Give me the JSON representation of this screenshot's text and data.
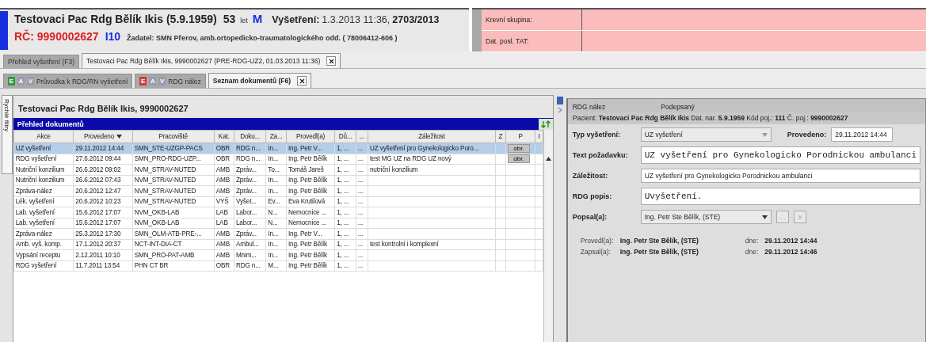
{
  "patient_header": {
    "name": "Testovaci Pac Rdg Bělík Ikis (5.9.1959)",
    "age": "53",
    "age_unit": "let",
    "sex": "M",
    "exam_label": "Vyšetření:",
    "exam_datetime": "1.3.2013 11:36,",
    "exam_number": "2703/2013",
    "rc": "RČ: 9990002627",
    "code": "I10",
    "requester": "Žadatel: SMN Přerov, amb.ortopedicko-traumatologického odd. ( 78006412-606 )"
  },
  "info_fields": [
    {
      "label": "Krevní skupina:"
    },
    {
      "label": "Dat. posl. TAT:"
    }
  ],
  "tabs": [
    {
      "label": "Přehled vyšetření (F3)",
      "selected": false,
      "closable": false
    },
    {
      "label": "Testovaci Pac Rdg Bělík Ikis, 9990002627 (PRE-RDG-UZ2, 01.03.2013 11:36)",
      "selected": true,
      "closable": true
    }
  ],
  "subtabs": [
    {
      "label": "Průvodka k RDG/RN vyšetření",
      "selected": false,
      "closable": false,
      "badges": [
        {
          "text": "E",
          "color": "#2e9e3e"
        },
        {
          "text": "A",
          "color": "#9a9ab0"
        },
        {
          "text": "V",
          "color": "#9a9ab0"
        }
      ]
    },
    {
      "label": "RDG nález",
      "selected": false,
      "closable": false,
      "badges": [
        {
          "text": "E",
          "color": "#d23a3a"
        },
        {
          "text": "A",
          "color": "#9a9ab0"
        },
        {
          "text": "V",
          "color": "#9a9ab0"
        }
      ]
    },
    {
      "label": "Seznam dokumentů (F6)",
      "selected": true,
      "closable": true
    }
  ],
  "side_tab": {
    "label": "Rychlé filtry"
  },
  "documents": {
    "title": "Testovaci Pac Rdg Bělík Ikis, 9990002627",
    "bar_title": "Přehled dokumentů",
    "columns": [
      {
        "label": "Akce",
        "sorted": false
      },
      {
        "label": "Provedeno",
        "sorted": true
      },
      {
        "label": "Pracoviště",
        "sorted": false
      },
      {
        "label": "Kat.",
        "sorted": false
      },
      {
        "label": "Doku...",
        "sorted": false
      },
      {
        "label": "Za...",
        "sorted": false
      },
      {
        "label": "Provedl(a)",
        "sorted": false
      },
      {
        "label": "Dů...",
        "sorted": false
      },
      {
        "label": "...",
        "sorted": false
      },
      {
        "label": "Záležitost",
        "sorted": false
      },
      {
        "label": "Z",
        "sorted": false
      },
      {
        "label": "P",
        "sorted": false
      },
      {
        "label": "I",
        "sorted": false
      }
    ],
    "rows": [
      {
        "selected": true,
        "cells": [
          "UZ vyšetření",
          "29.11.2012 14:44",
          "SMN_STE-UZGP-PACS",
          "OBR",
          "RDG n...",
          "In...",
          "Ing. Petr V...",
          "1, ...",
          "...",
          "UZ vyšetření pro Gynekologicko Poro..."
        ],
        "p": "obr."
      },
      {
        "selected": false,
        "cells": [
          "RDG vyšetření",
          "27.6.2012 09:44",
          "SMN_PRO-RDG-UZP...",
          "OBR",
          "RDG n...",
          "In...",
          "Ing. Petr Bělík",
          "1, ...",
          "...",
          "test MG UZ na RDG UZ nový"
        ],
        "p": "obr."
      },
      {
        "selected": false,
        "cells": [
          "Nutriční konzilium",
          "26.6.2012 09:02",
          "NVM_STRAV-NUTED",
          "AMB",
          "Zpráv...",
          "To...",
          "Tomáš Jareš",
          "1, ...",
          "...",
          "nutriční konzilium"
        ]
      },
      {
        "selected": false,
        "cells": [
          "Nutriční konzilium",
          "26.6.2012 07:43",
          "NVM_STRAV-NUTED",
          "AMB",
          "Zpráv...",
          "In...",
          "Ing. Petr Bělík",
          "1, ...",
          "..."
        ]
      },
      {
        "selected": false,
        "cells": [
          "Zpráva-nález",
          "20.6.2012 12:47",
          "NVM_STRAV-NUTED",
          "AMB",
          "Zpráv...",
          "In...",
          "Ing. Petr Bělík",
          "1, ...",
          "..."
        ]
      },
      {
        "selected": false,
        "cells": [
          "Lék. vyšetření",
          "20.6.2012 10:23",
          "NVM_STRAV-NUTED",
          "VYŠ",
          "Vyšet...",
          "Ev...",
          "Eva Krutilová",
          "1, ...",
          "..."
        ]
      },
      {
        "selected": false,
        "cells": [
          "Lab. vyšetření",
          "15.6.2012 17:07",
          "NVM_OKB-LAB",
          "LAB",
          "Labor...",
          "N...",
          "Nemocnice ...",
          "1, ...",
          "..."
        ]
      },
      {
        "selected": false,
        "cells": [
          "Lab. vyšetření",
          "15.6.2012 17:07",
          "NVM_OKB-LAB",
          "LAB",
          "Labor...",
          "N...",
          "Nemocnice ...",
          "1, ...",
          "..."
        ]
      },
      {
        "selected": false,
        "cells": [
          "Zpráva-nález",
          "25.3.2012 17:30",
          "SMN_OLM-ATB-PRE-...",
          "AMB",
          "Zpráv...",
          "In...",
          "Ing. Petr V...",
          "1, ...",
          "..."
        ]
      },
      {
        "selected": false,
        "cells": [
          "Amb. vyš. komp.",
          "17.1.2012 20:37",
          "NCT-INT-DIA-CT",
          "AMB",
          "Ambul...",
          "In...",
          "Ing. Petr Bělík",
          "1, ...",
          "...",
          "test kontrolní i komplexní"
        ]
      },
      {
        "selected": false,
        "cells": [
          "Vypsání receptu",
          "2.12.2011 10:10",
          "SMN_PRO-PAT-AMB",
          "AMB",
          "Mnim...",
          "In...",
          "Ing. Petr Bělík",
          "1, ...",
          "..."
        ]
      },
      {
        "selected": false,
        "cells": [
          "RDG vyšetření",
          "11.7.2011 13:54",
          "PHN CT BR",
          "OBR",
          "RDG n...",
          "M...",
          "Ing. Petr Bělík",
          "1, ...",
          "..."
        ]
      }
    ]
  },
  "detail": {
    "doc_type": "RDG nález",
    "status": "Podepsaný",
    "patient_line": "Pacient: **Testovaci Pac Rdg Bělík Ikis** Dat. nar. **5.9.1959** Kód poj.: **111** Č. poj.: **9990002627**",
    "fields": [
      {
        "kind": "dropdown",
        "label": "Typ vyšetření:",
        "value": "UZ vyšetření",
        "extra_label": "Provedeno:",
        "extra_value": "29.11.2012 14:44"
      },
      {
        "kind": "mono",
        "label": "Text požadavku:",
        "value": "UZ vyšetření pro Gynekologicko Porodnickou ambulanci"
      },
      {
        "kind": "text",
        "label": "Záležitost:",
        "value": "UZ vyšetření pro Gynekologicko Porodnickou ambulanci"
      },
      {
        "kind": "mono",
        "label": "RDG popis:",
        "value": "Uvyšetření."
      },
      {
        "kind": "person",
        "label": "Popsal(a):",
        "value": "Ing. Petr Ste Bělík, (STE)",
        "button1": "...",
        "button2": "X"
      }
    ],
    "signatures": [
      {
        "label": "Provedl(a):",
        "name": "Ing. Petr Ste Bělík, (STE)",
        "date_label": "dne:",
        "date": "29.11.2012 14:44"
      },
      {
        "label": "Zapsal(a):",
        "name": "Ing. Petr Ste Bělík, (STE)",
        "date_label": "dne:",
        "date": "29.11.2012 14:46"
      }
    ]
  }
}
